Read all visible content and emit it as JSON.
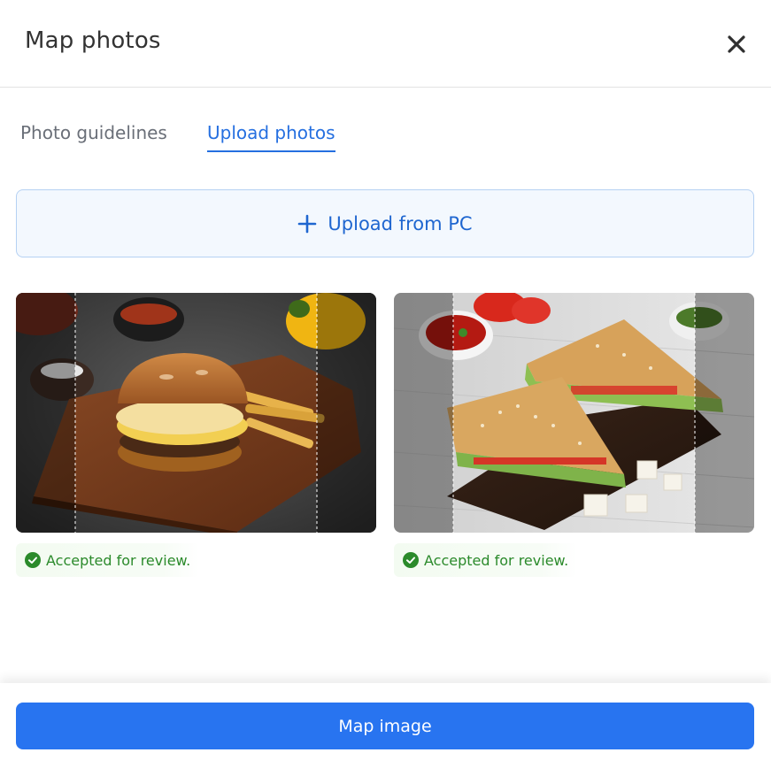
{
  "dialog": {
    "title": "Map photos",
    "close_icon": "close-icon"
  },
  "tabs": [
    {
      "label": "Photo guidelines",
      "active": false
    },
    {
      "label": "Upload photos",
      "active": true
    }
  ],
  "upload": {
    "label": "Upload from PC",
    "icon": "plus-icon"
  },
  "photos": [
    {
      "description_icon": "burger-photo",
      "status": "Accepted for review."
    },
    {
      "description_icon": "sandwich-photo",
      "status": "Accepted for review."
    }
  ],
  "footer": {
    "primary_label": "Map image"
  },
  "colors": {
    "accent": "#2874f0",
    "tab_active": "#256fe0",
    "success": "#2b8a2b"
  }
}
